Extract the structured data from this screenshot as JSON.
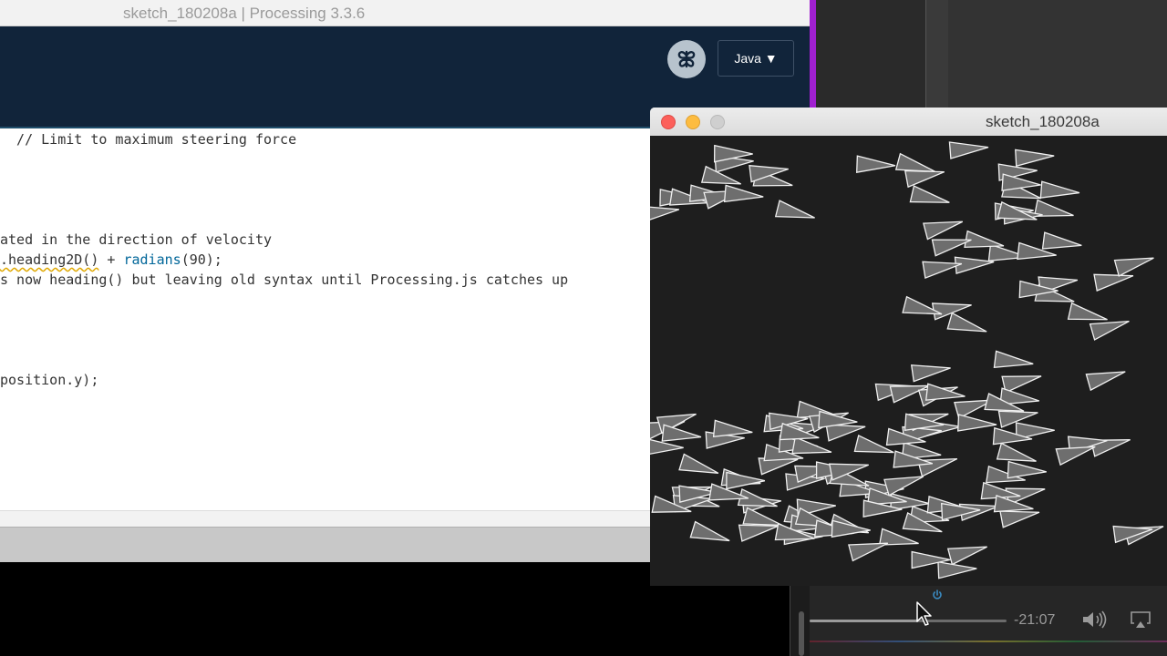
{
  "ide": {
    "title": "sketch_180208a | Processing 3.3.6",
    "mode_label": "Java ▼",
    "code_lines": [
      {
        "text": "  // Limit to maximum steering force"
      },
      {
        "text": "ated in the direction of velocity"
      },
      {
        "pre": ".heading2D()",
        "mid": " + ",
        "fn": "radians",
        "post": "(90);"
      },
      {
        "text": "s now heading() but leaving old syntax until Processing.js catches up"
      },
      {
        "text": "position.y);"
      }
    ]
  },
  "sketch": {
    "title": "sketch_180208a",
    "boid_fill": "#6e6e6e",
    "boid_stroke": "#f0f0f0",
    "canvas_bg": "#1e1e1e"
  },
  "video": {
    "time_remaining": "-21:07",
    "progress": 0.55
  },
  "colors": {
    "toolbar": "#11243a",
    "accent_purple": "#a020d0",
    "keyword_blue": "#006699",
    "close": "#fc605b",
    "minimize": "#fdbc40"
  }
}
